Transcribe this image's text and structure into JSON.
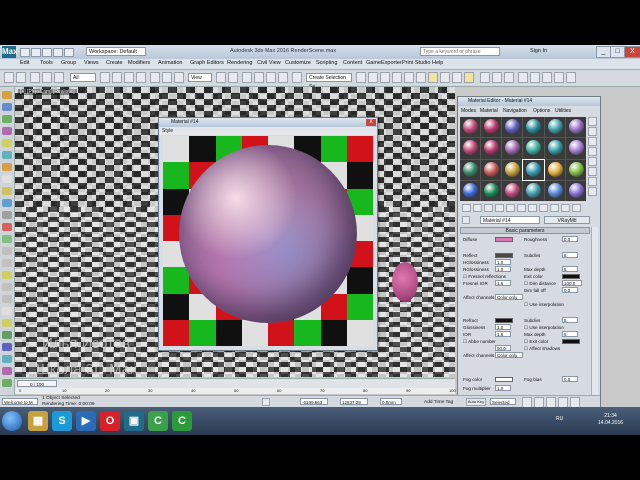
{
  "window": {
    "app_logo": "Max",
    "workspace": "Workspace: Default",
    "title": "Autodesk 3ds Max 2016    RenderScene.max",
    "search_placeholder": "Type a keyword or phrase",
    "sign_in": "Sign In",
    "controls": [
      "_",
      "□",
      "X"
    ]
  },
  "menu": [
    "Edit",
    "Tools",
    "Group",
    "Views",
    "Create",
    "Modifiers",
    "Animation",
    "Graph Editors",
    "Rendering",
    "Civil View",
    "Customize",
    "Scripting",
    "Content",
    "GameExporter",
    "Print Studio",
    "Help"
  ],
  "toolbar": {
    "selection_filter": "All",
    "named_selection": "Create Selection Se",
    "view_dropdown": "View"
  },
  "viewport": {
    "label": "[+] [PhysCam] [Realistic]"
  },
  "preview": {
    "title": "Material #14",
    "toolbar_label": "Style",
    "checker_colors": [
      "#17b81d",
      "#1b1fd6",
      "#101010",
      "#e0e0e0",
      "#d1121b"
    ],
    "close": "X"
  },
  "material_editor": {
    "title": "Material Editor - Material #14",
    "menu": [
      "Modes",
      "Material",
      "Navigation",
      "Options",
      "Utilities"
    ],
    "slot_colors": [
      "#c04a7a",
      "#b83b6e",
      "#6060c0",
      "#2a8fa0",
      "#40a0b0",
      "#9a70c8",
      "#c04a7a",
      "#b83b6e",
      "#a06ab0",
      "#40b0a0",
      "#3aa0a8",
      "#a880d8",
      "#3a8a6a",
      "#c85a5a",
      "#c8a040",
      "#3a9ab0",
      "#e0b040",
      "#80c040",
      "#3a6ad8",
      "#1a8a5a",
      "#c04a7a",
      "#40a0b0",
      "#5a8ad8",
      "#8a70d8"
    ],
    "material_name": "Material #14",
    "material_type": "VRayMtl",
    "rollout_basic": "Basic parameters",
    "diffuse_label": "Diffuse",
    "roughness_label": "Roughness",
    "roughness_value": "0.0",
    "reflect_label": "Reflect",
    "subdivs_label": "Subdivs",
    "subdivs_value": "8",
    "hilight_label": "HGlossiness",
    "hilight_value": "1.0",
    "rglossiness_label": "RGlossiness",
    "rglossiness_value": "1.0",
    "maxdepth_label": "Max depth",
    "maxdepth_value": "5",
    "fresnel_label": "Fresnel reflections",
    "exitcolor_label": "Exit color",
    "fresnel_ior_label": "Fresnel IOR",
    "fresnel_ior_value": "1.6",
    "dimdist_label": "Dim distance",
    "dimdist_value": "100.0",
    "dimfall_label": "Dim fall off",
    "dimfall_value": "0.0",
    "affect_channels_label": "Affect channels",
    "affect_channels_value": "Color only",
    "use_interp_label": "Use interpolation",
    "refract_label": "Refract",
    "refract_subdivs": "8",
    "glossiness_label": "Glossiness",
    "glossiness_value": "1.0",
    "ior_label": "IOR",
    "ior_value": "1.6",
    "ref_maxdepth": "5",
    "abbe_label": "Abbe number",
    "abbe_value": "50.0",
    "ref_exitcolor_label": "Exit color",
    "affect_shadows_label": "Affect shadows",
    "ref_affect_channels_label": "Affect channels",
    "ref_affect_channels_value": "Color only",
    "ref_use_interp_label": "Use interpolation",
    "fog_color_label": "Fog color",
    "fog_bias_label": "Fog bias",
    "fog_bias_value": "0.0",
    "fog_mult_label": "Fog multiplier",
    "fog_mult_value": "1.0"
  },
  "timeline": {
    "slider": "0 / 100",
    "ticks": [
      "0",
      "10",
      "20",
      "30",
      "40",
      "50",
      "60",
      "70",
      "80",
      "90",
      "100"
    ]
  },
  "status": {
    "selected": "1 Object Selected",
    "rendering": "Rendering Time: 0:00:09",
    "welcome": "Welcome to M",
    "x_value": "-6199.663",
    "y_value": "12837.29",
    "z_value": "0.0mm",
    "add_time_tag": "Add Time Tag",
    "auto_key": "Auto Key",
    "selected_dd": "Selected"
  },
  "watermark": {
    "line1": "Илья Изотов",
    "line2": "Школа 3D Max"
  },
  "taskbar": {
    "apps": [
      {
        "icon": "folder-icon",
        "glyph": "▦",
        "color": "#c8a040"
      },
      {
        "icon": "skype-icon",
        "glyph": "S",
        "color": "#1a9ad8"
      },
      {
        "icon": "media-icon",
        "glyph": "▶",
        "color": "#2a6ab8"
      },
      {
        "icon": "opera-icon",
        "glyph": "O",
        "color": "#d8202a"
      },
      {
        "icon": "3dsmax-icon",
        "glyph": "▣",
        "color": "#1f6c8a"
      },
      {
        "icon": "camtasia-icon",
        "glyph": "C",
        "color": "#3aa04a"
      },
      {
        "icon": "camtasia-recorder-icon",
        "glyph": "C",
        "color": "#2a9a3a"
      }
    ],
    "tray_lang": "RU",
    "time": "21:34",
    "date": "14.04.2016"
  }
}
